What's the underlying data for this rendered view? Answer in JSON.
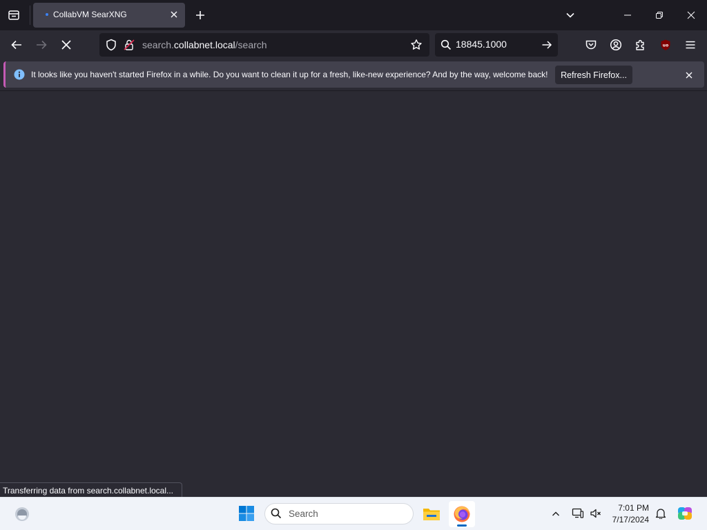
{
  "browser": {
    "tab": {
      "title": "CollabVM SearXNG"
    },
    "url": {
      "prefix": "search.",
      "domain": "collabnet.local",
      "path": "/search"
    },
    "search_box": {
      "value": "18845.1000"
    }
  },
  "notification": {
    "message": "It looks like you haven't started Firefox in a while. Do you want to clean it up for a fresh, like-new experience? And by the way, welcome back!",
    "button_label": "Refresh Firefox..."
  },
  "status_bar": {
    "text": "Transferring data from search.collabnet.local..."
  },
  "taskbar": {
    "search_placeholder": "Search",
    "clock": {
      "time": "7:01 PM",
      "date": "7/17/2024"
    }
  },
  "icons": {
    "tab_list": "tab-list-icon",
    "new_tab": "plus-icon",
    "back": "back-arrow-icon",
    "forward": "forward-arrow-icon",
    "stop": "stop-icon",
    "shield": "shield-icon",
    "lock": "lock-icon",
    "bookmark": "star-icon",
    "search": "search-icon",
    "pocket": "pocket-icon",
    "account": "account-icon",
    "extensions": "puzzle-icon",
    "ublock": "ublock-icon",
    "menu": "hamburger-icon"
  },
  "colors": {
    "toolbar": "#2b2a33",
    "tabstrip": "#1c1b22",
    "notification": "#42414d",
    "accent": "#c45ab4",
    "taskbar": "#f0f3f9"
  }
}
